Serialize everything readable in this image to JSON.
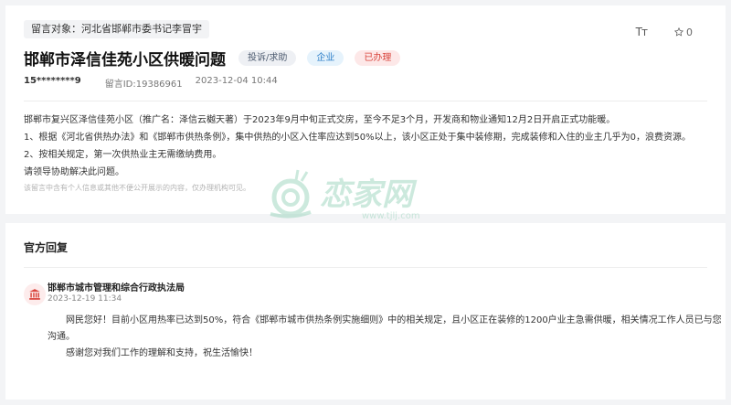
{
  "message": {
    "target": "留言对象：河北省邯郸市委书记李冒宇",
    "font_size_label": "Tт",
    "star_count": "0",
    "title": "邯郸市泽信佳苑小区供暖问题",
    "tags": {
      "type": "投诉/求助",
      "domain": "企业",
      "status": "已办理"
    },
    "user": "15********9",
    "message_id": "留言ID:19386961",
    "date": "2023-12-04 10:44",
    "content": [
      "邯郸市复兴区泽信佳苑小区（推广名：泽信云樾天著）于2023年9月中旬正式交房，至今不足3个月，开发商和物业通知12月2日开启正式功能暖。",
      "1、根据《河北省供热办法》和《邯郸市供热条例》，集中供热的小区入住率应达到50%以上，该小区正处于集中装修期，完成装修和入住的业主几乎为0，浪费资源。",
      "2、按相关规定，第一次供热业主无需缴纳费用。",
      "请领导协助解决此问题。"
    ],
    "disclaimer": "该留言中含有个人信息或其他不便公开展示的内容，仅办理机构可见。",
    "watermark": {
      "brand": "恋家网",
      "url": "www.tjlj.com"
    }
  },
  "reply": {
    "section_title": "官方回复",
    "department": "邯郸市城市管理和综合行政执法局",
    "time": "2023-12-19 11:34",
    "paragraphs": [
      "网民您好！目前小区用热率已达到50%，符合《邯郸市城市供热条例实施细则》中的相关规定，且小区正在装修的1200户业主急需供暖，相关情况工作人员已与您沟通。",
      "感谢您对我们工作的理解和支持，祝生活愉快！"
    ]
  },
  "colors": {
    "accent_red": "#d9453d",
    "accent_blue": "#2b7dc8",
    "watermark_green": "#8fd0b4"
  }
}
